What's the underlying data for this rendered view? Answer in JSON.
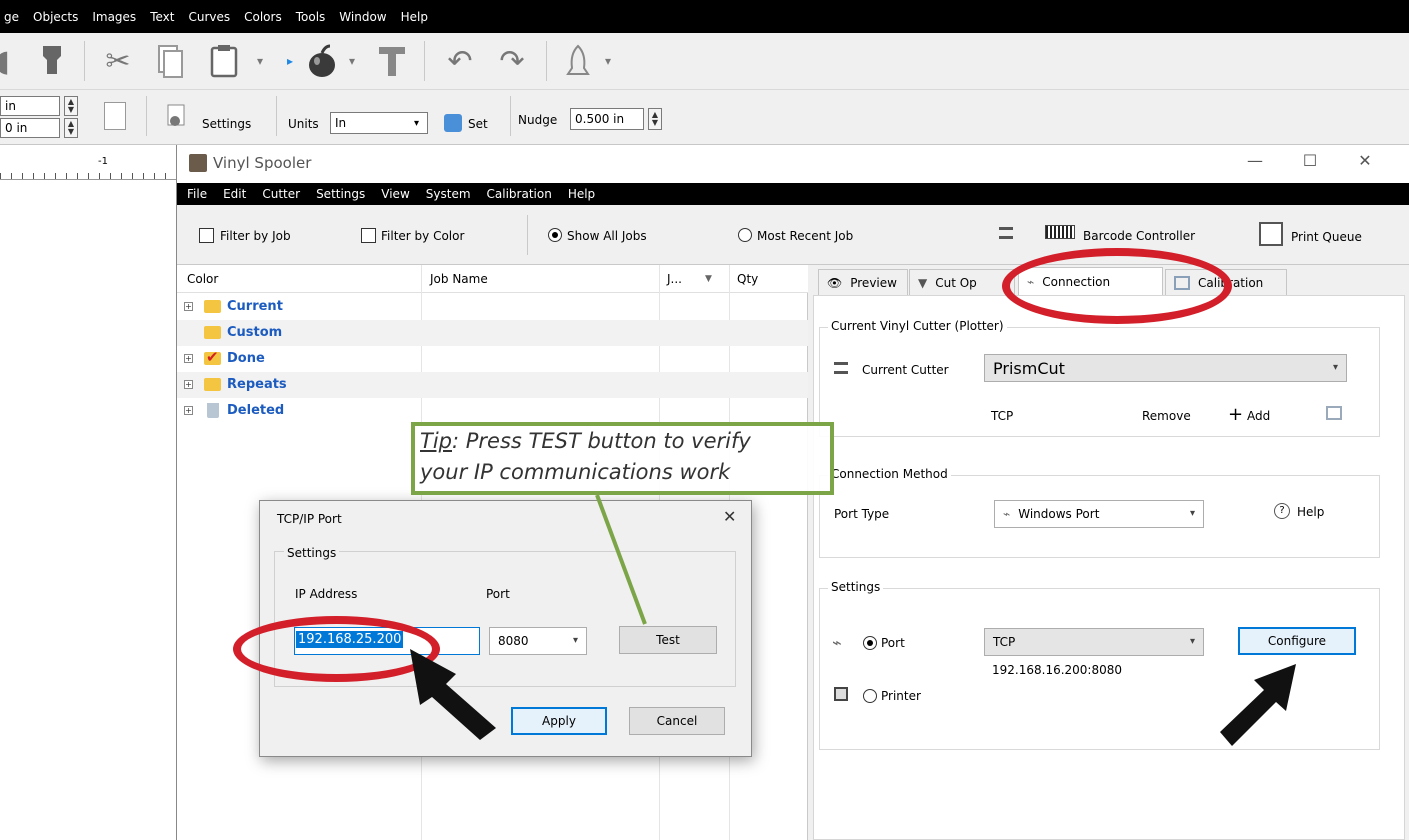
{
  "app": {
    "menu": [
      "ge",
      "Objects",
      "Images",
      "Text",
      "Curves",
      "Colors",
      "Tools",
      "Window",
      "Help"
    ],
    "props": {
      "field1": "in",
      "field2": "0 in",
      "settings": "Settings",
      "units_label": "Units",
      "units_value": "In",
      "set": "Set",
      "nudge_label": "Nudge",
      "nudge_value": "0.500 in",
      "ruler_tick": "-1"
    }
  },
  "spooler": {
    "title": "Vinyl Spooler",
    "window_controls": [
      "—",
      "☐",
      "✕"
    ],
    "menu": [
      "File",
      "Edit",
      "Cutter",
      "Settings",
      "View",
      "System",
      "Calibration",
      "Help"
    ],
    "toolbar": {
      "filter_job": "Filter by Job",
      "filter_color": "Filter by Color",
      "show_all": "Show All Jobs",
      "most_recent": "Most Recent Job",
      "barcode": "Barcode Controller",
      "print_queue": "Print Queue"
    },
    "columns": [
      "Color",
      "Job Name",
      "J...",
      "Qty"
    ],
    "rows": [
      "Current",
      "Custom",
      "Done",
      "Repeats",
      "Deleted"
    ],
    "tabs": [
      "Preview",
      "Cut Op",
      "Connection",
      "Calibration"
    ],
    "cutter_group": {
      "title": "Current Vinyl Cutter (Plotter)",
      "label": "Current Cutter",
      "value": "PrismCut",
      "protocol": "TCP",
      "remove": "Remove",
      "add": "Add"
    },
    "connection_group": {
      "title": "Connection Method",
      "port_type_label": "Port Type",
      "port_type_value": "Windows Port",
      "help": "Help"
    },
    "settings_group": {
      "title": "Settings",
      "port_label": "Port",
      "port_value": "TCP",
      "address": "192.168.16.200:8080",
      "printer_label": "Printer",
      "configure": "Configure"
    }
  },
  "dialog": {
    "title": "TCP/IP Port",
    "close": "✕",
    "group": "Settings",
    "ip_label": "IP Address",
    "ip_value": "192.168.25.200",
    "port_label": "Port",
    "port_value": "8080",
    "test": "Test",
    "apply": "Apply",
    "cancel": "Cancel"
  },
  "annotation": {
    "tip_word": "Tip",
    "tip_line1_rest": ": Press TEST button to verify",
    "tip_line2": "your IP communications work",
    "accent_red": "#d31f2a",
    "accent_green": "#7ca548"
  }
}
